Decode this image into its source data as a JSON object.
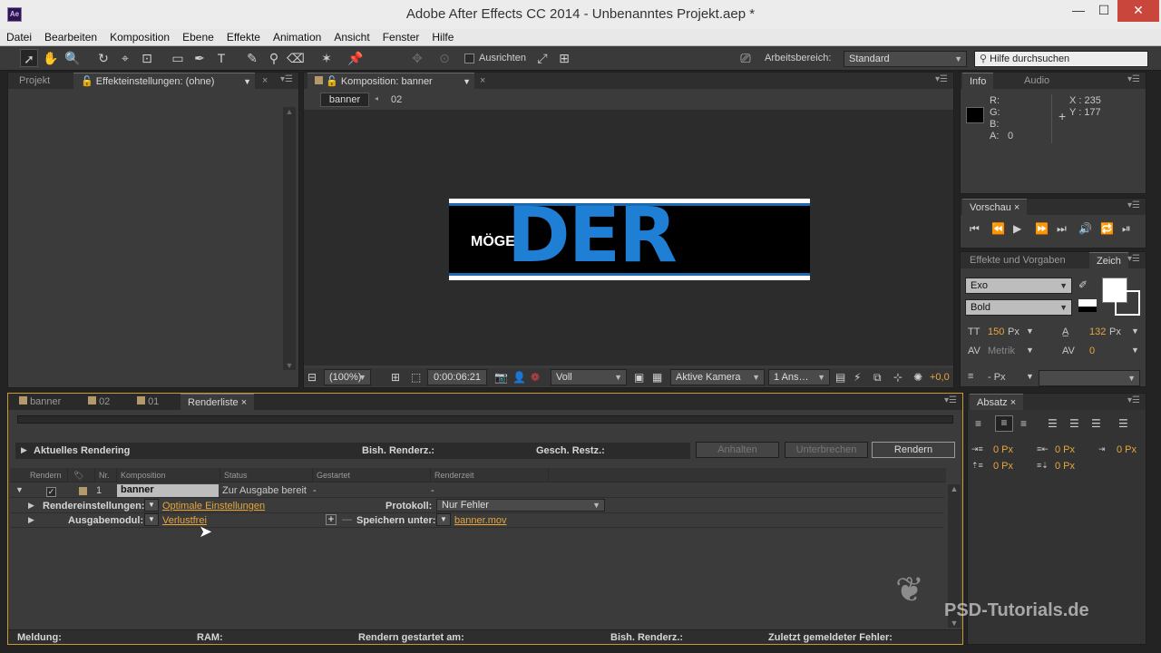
{
  "window": {
    "title": "Adobe After Effects CC 2014 - Unbenanntes Projekt.aep *",
    "logo_text": "Ae",
    "min": "—",
    "max": "☐",
    "close": "✕"
  },
  "menu": [
    "Datei",
    "Bearbeiten",
    "Komposition",
    "Ebene",
    "Effekte",
    "Animation",
    "Ansicht",
    "Fenster",
    "Hilfe"
  ],
  "toolbar": {
    "align_label": "Ausrichten",
    "workspace_label": "Arbeitsbereich:",
    "workspace_value": "Standard",
    "help_placeholder": "Hilfe durchsuchen"
  },
  "project_panel": {
    "tabs": [
      "Projekt",
      "Effekteinstellungen: (ohne)"
    ]
  },
  "comp_panel": {
    "tab": "Komposition: banner",
    "breadcrumb": [
      "banner",
      "02"
    ],
    "banner_text_small": "MÖGE",
    "banner_text_big": "DER",
    "zoom": "(100%)",
    "timecode": "0:00:06:21",
    "resolution": "Voll",
    "camera": "Aktive Kamera",
    "views": "1 Ans…",
    "exposure": "+0,0"
  },
  "info_panel": {
    "tabs": [
      "Info",
      "Audio"
    ],
    "r": "R:",
    "g": "G:",
    "b": "B:",
    "a": "A:",
    "a_value": "0",
    "x": "X : 235",
    "y": "Y : 177"
  },
  "preview_panel": {
    "tab": "Vorschau"
  },
  "char_panel": {
    "tabs": [
      "Effekte und Vorgaben",
      "Zeich"
    ],
    "font": "Exo",
    "style": "Bold",
    "size": "150",
    "size_unit": "Px",
    "leading": "132",
    "leading_unit": "Px",
    "kerning": "Metrik",
    "tracking": "0",
    "stroke_unit": "- Px"
  },
  "paragraph_panel": {
    "tab": "Absatz",
    "indent_values": [
      "0 Px",
      "0 Px",
      "0 Px",
      "0 Px",
      "0 Px"
    ]
  },
  "timeline_tabs": [
    "banner",
    "02",
    "01",
    "Renderliste"
  ],
  "render_queue": {
    "current_rendering": "Aktuelles Rendering",
    "elapsed_label": "Bish. Renderz.:",
    "remaining_label": "Gesch. Restz.:",
    "stop_btn": "Anhalten",
    "pause_btn": "Unterbrechen",
    "render_btn": "Rendern",
    "columns": [
      "Rendern",
      "Nr.",
      "Komposition",
      "Status",
      "Gestartet",
      "Renderzeit"
    ],
    "item": {
      "number": "1",
      "comp": "banner",
      "status": "Zur Ausgabe bereit",
      "started": "-",
      "render_time": "-",
      "render_settings_label": "Rendereinstellungen:",
      "render_settings_value": "Optimale Einstellungen",
      "log_label": "Protokoll:",
      "log_value": "Nur Fehler",
      "output_module_label": "Ausgabemodul:",
      "output_module_value": "Verlustfrei",
      "output_to_label": "Speichern unter:",
      "output_to_value": "banner.mov"
    },
    "footer": {
      "message": "Meldung:",
      "ram": "RAM:",
      "render_started": "Rendern gestartet am:",
      "elapsed": "Bish. Renderz.:",
      "last_error": "Zuletzt gemeldeter Fehler:"
    }
  },
  "watermark": "PSD-Tutorials.de",
  "colors": {
    "orange": "#e8a63a",
    "blue_text": "#1f7fd4"
  }
}
